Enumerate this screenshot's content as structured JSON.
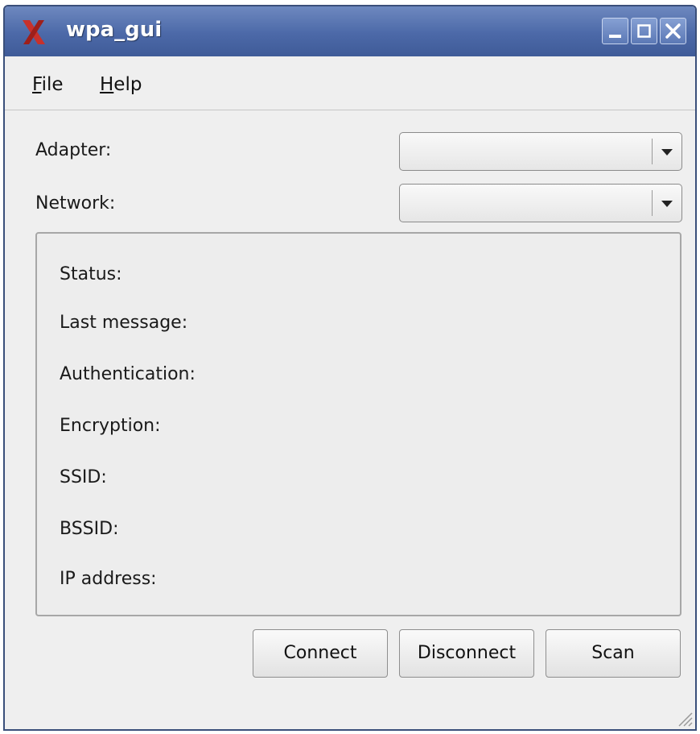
{
  "window": {
    "title": "wpa_gui",
    "app_icon": "x-icon",
    "controls": [
      "minimize-icon",
      "maximize-icon",
      "close-icon"
    ]
  },
  "menu": {
    "file": {
      "mnemonic": "F",
      "rest": "ile"
    },
    "help": {
      "mnemonic": "H",
      "rest": "elp"
    }
  },
  "form": {
    "adapter_label": "Adapter:",
    "adapter_value": "",
    "network_label": "Network:",
    "network_value": ""
  },
  "status": {
    "status_label": "Status:",
    "last_message_label": "Last message:",
    "authentication_label": "Authentication:",
    "encryption_label": "Encryption:",
    "ssid_label": "SSID:",
    "bssid_label": "BSSID:",
    "ip_address_label": "IP address:"
  },
  "buttons": {
    "connect": "Connect",
    "disconnect": "Disconnect",
    "scan": "Scan"
  },
  "colors": {
    "titlebar": "#4c69a8",
    "app_icon": "#c8312b",
    "window_bg": "#efefef"
  }
}
